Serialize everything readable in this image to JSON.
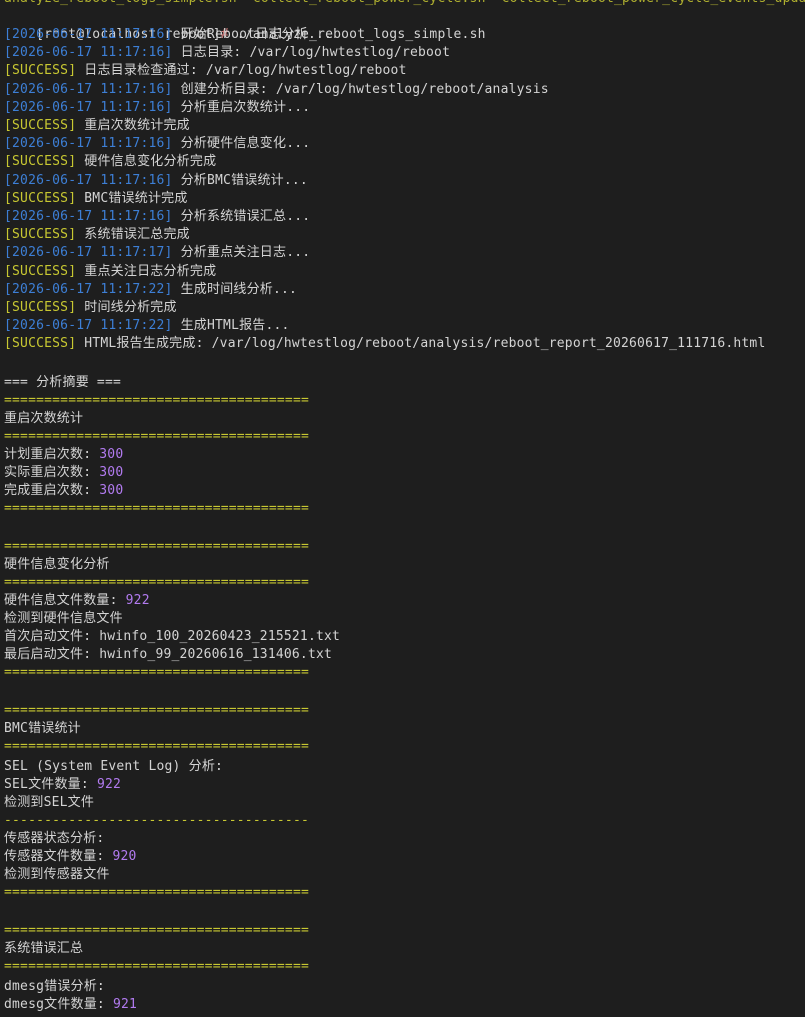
{
  "window": {
    "partial_top_line": "analyze_reboot_logs_simple.sh  collect_reboot_power_cycle.sh  collect_reboot_power_cycle_events_upda"
  },
  "prompt": {
    "user_host": "[root@localhost reboot]",
    "symbol": "#",
    "command": " ./analyze_reboot_logs_simple.sh"
  },
  "log": [
    {
      "kind": "ts",
      "tag": "[2026-06-17 11:17:16]",
      "msg": " 开始Reboot日志分析..."
    },
    {
      "kind": "ts",
      "tag": "[2026-06-17 11:17:16]",
      "msg": " 日志目录: /var/log/hwtestlog/reboot"
    },
    {
      "kind": "ok",
      "tag": "[SUCCESS]",
      "msg": " 日志目录检查通过: /var/log/hwtestlog/reboot"
    },
    {
      "kind": "ts",
      "tag": "[2026-06-17 11:17:16]",
      "msg": " 创建分析目录: /var/log/hwtestlog/reboot/analysis"
    },
    {
      "kind": "ts",
      "tag": "[2026-06-17 11:17:16]",
      "msg": " 分析重启次数统计..."
    },
    {
      "kind": "ok",
      "tag": "[SUCCESS]",
      "msg": " 重启次数统计完成"
    },
    {
      "kind": "ts",
      "tag": "[2026-06-17 11:17:16]",
      "msg": " 分析硬件信息变化..."
    },
    {
      "kind": "ok",
      "tag": "[SUCCESS]",
      "msg": " 硬件信息变化分析完成"
    },
    {
      "kind": "ts",
      "tag": "[2026-06-17 11:17:16]",
      "msg": " 分析BMC错误统计..."
    },
    {
      "kind": "ok",
      "tag": "[SUCCESS]",
      "msg": " BMC错误统计完成"
    },
    {
      "kind": "ts",
      "tag": "[2026-06-17 11:17:16]",
      "msg": " 分析系统错误汇总..."
    },
    {
      "kind": "ok",
      "tag": "[SUCCESS]",
      "msg": " 系统错误汇总完成"
    },
    {
      "kind": "ts",
      "tag": "[2026-06-17 11:17:17]",
      "msg": " 分析重点关注日志..."
    },
    {
      "kind": "ok",
      "tag": "[SUCCESS]",
      "msg": " 重点关注日志分析完成"
    },
    {
      "kind": "ts",
      "tag": "[2026-06-17 11:17:22]",
      "msg": " 生成时间线分析..."
    },
    {
      "kind": "ok",
      "tag": "[SUCCESS]",
      "msg": " 时间线分析完成"
    },
    {
      "kind": "ts",
      "tag": "[2026-06-17 11:17:22]",
      "msg": " 生成HTML报告..."
    },
    {
      "kind": "ok",
      "tag": "[SUCCESS]",
      "msg": " HTML报告生成完成: /var/log/hwtestlog/reboot/analysis/reboot_report_20260617_111716.html"
    }
  ],
  "summary": {
    "heading": "=== 分析摘要 ===",
    "rule_eq": "======================================",
    "rule_dash": "--------------------------------------",
    "reboot": {
      "title": "重启次数统计",
      "rows": [
        {
          "label": "计划重启次数: ",
          "value": "300"
        },
        {
          "label": "实际重启次数: ",
          "value": "300"
        },
        {
          "label": "完成重启次数: ",
          "value": "300"
        }
      ]
    },
    "hardware": {
      "title": "硬件信息变化分析",
      "count_label": "硬件信息文件数量: ",
      "count_value": "922",
      "detected": "检测到硬件信息文件",
      "first": "首次启动文件: hwinfo_100_20260423_215521.txt",
      "last": "最后启动文件: hwinfo_99_20260616_131406.txt"
    },
    "bmc": {
      "title": "BMC错误统计",
      "sel_heading": "SEL (System Event Log) 分析:",
      "sel_count_label": "SEL文件数量: ",
      "sel_count_value": "922",
      "sel_detected": "检测到SEL文件",
      "sensor_heading": "传感器状态分析:",
      "sensor_count_label": "传感器文件数量: ",
      "sensor_count_value": "920",
      "sensor_detected": "检测到传感器文件"
    },
    "system": {
      "title": "系统错误汇总",
      "dmesg_heading": "dmesg错误分析:",
      "dmesg_count_label": "dmesg文件数量: ",
      "dmesg_count_value": "921"
    }
  }
}
